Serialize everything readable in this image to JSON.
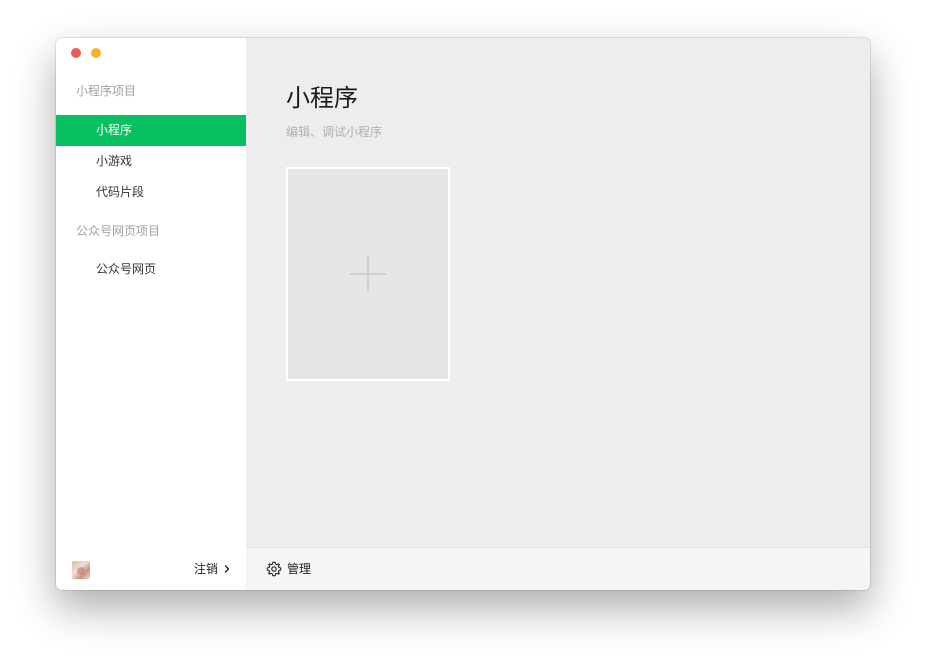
{
  "window": {
    "controls": [
      "close",
      "minimize"
    ]
  },
  "sidebar": {
    "sections": [
      {
        "title": "小程序项目",
        "items": [
          {
            "label": "小程序",
            "active": true
          },
          {
            "label": "小游戏",
            "active": false
          },
          {
            "label": "代码片段",
            "active": false
          }
        ]
      },
      {
        "title": "公众号网页项目",
        "items": [
          {
            "label": "公众号网页",
            "active": false
          }
        ]
      }
    ],
    "footer": {
      "logout_label": "注销"
    }
  },
  "main": {
    "title": "小程序",
    "subtitle": "编辑、调试小程序",
    "footer": {
      "manage_label": "管理"
    }
  },
  "colors": {
    "accent": "#07c160",
    "close": "#ed5b58",
    "minimize": "#f2b22c"
  },
  "icons": {
    "add": "plus-icon",
    "manage": "gear-icon",
    "logout": "chevron-right-icon"
  }
}
